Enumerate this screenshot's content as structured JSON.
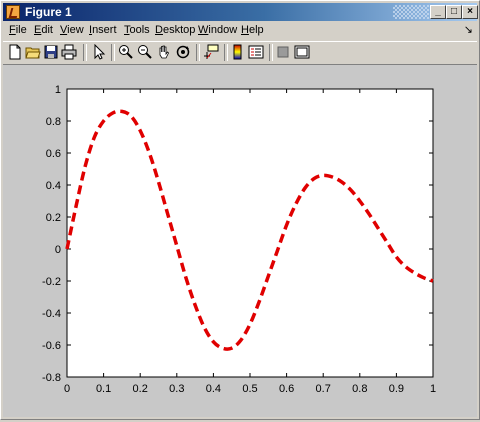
{
  "window": {
    "title": "Figure 1"
  },
  "menu": {
    "items": [
      "File",
      "Edit",
      "View",
      "Insert",
      "Tools",
      "Desktop",
      "Window",
      "Help"
    ],
    "dock_glyph": "↘"
  },
  "toolbar": {
    "icons": [
      "new-file-icon",
      "open-folder-icon",
      "save-icon",
      "print-icon",
      "arrow-select-icon",
      "zoom-in-icon",
      "zoom-out-icon",
      "pan-hand-icon",
      "rotate-3d-icon",
      "data-cursor-icon",
      "colorbar-icon",
      "legend-icon",
      "hide-plot-tools-icon",
      "show-plot-tools-icon"
    ]
  },
  "chart_data": {
    "type": "line",
    "title": "",
    "xlabel": "",
    "ylabel": "",
    "xlim": [
      0,
      1
    ],
    "ylim": [
      -0.8,
      1
    ],
    "x_ticks": [
      0,
      0.1,
      0.2,
      0.3,
      0.4,
      0.5,
      0.6,
      0.7,
      0.8,
      0.9,
      1
    ],
    "x_tick_labels": [
      "0",
      "0.1",
      "0.2",
      "0.3",
      "0.4",
      "0.5",
      "0.6",
      "0.7",
      "0.8",
      "0.9",
      "1"
    ],
    "y_ticks": [
      -0.8,
      -0.6,
      -0.4,
      -0.2,
      0,
      0.2,
      0.4,
      0.6,
      0.8,
      1
    ],
    "y_tick_labels": [
      "-0.8",
      "-0.6",
      "-0.4",
      "-0.2",
      "0",
      "0.2",
      "0.4",
      "0.6",
      "0.8",
      "1"
    ],
    "grid": false,
    "series": [
      {
        "color": "#e00000",
        "line_style": "dashed",
        "x": [
          0,
          0.025,
          0.05,
          0.075,
          0.1,
          0.125,
          0.15,
          0.175,
          0.2,
          0.225,
          0.25,
          0.275,
          0.3,
          0.325,
          0.35,
          0.375,
          0.4,
          0.425,
          0.45,
          0.475,
          0.5,
          0.525,
          0.55,
          0.575,
          0.6,
          0.625,
          0.65,
          0.675,
          0.7,
          0.725,
          0.75,
          0.775,
          0.8,
          0.825,
          0.85,
          0.875,
          0.9,
          0.925,
          0.95,
          0.975,
          1
        ],
        "y": [
          0,
          0.27,
          0.52,
          0.7,
          0.8,
          0.85,
          0.86,
          0.83,
          0.74,
          0.6,
          0.42,
          0.22,
          0.02,
          -0.18,
          -0.35,
          -0.49,
          -0.58,
          -0.62,
          -0.62,
          -0.57,
          -0.47,
          -0.33,
          -0.17,
          -0.01,
          0.15,
          0.28,
          0.38,
          0.44,
          0.46,
          0.45,
          0.42,
          0.37,
          0.3,
          0.22,
          0.13,
          0.04,
          -0.05,
          -0.11,
          -0.15,
          -0.18,
          -0.2
        ]
      }
    ]
  }
}
